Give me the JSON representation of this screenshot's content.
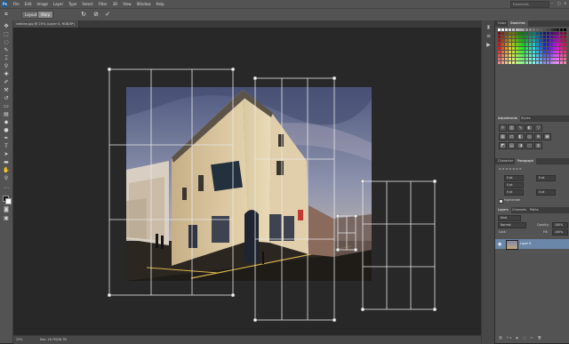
{
  "menubar": {
    "logo": "Ps",
    "items": [
      "File",
      "Edit",
      "Image",
      "Layer",
      "Type",
      "Select",
      "Filter",
      "3D",
      "View",
      "Window",
      "Help"
    ],
    "workspace": "Essentials",
    "winctl": [
      "–",
      "□",
      "✕"
    ]
  },
  "options": {
    "btn1": "Layout",
    "btn2": "Warp",
    "icons": [
      "rotate-icon",
      "cancel-icon",
      "commit-icon"
    ]
  },
  "document": {
    "tab": "rathlee.jpg @ 25% (Layer 0, RGB/8*) ✕",
    "zoom": "25%",
    "doc_size": "Doc: 16.7M/26.7M"
  },
  "panels": {
    "color_tabs": [
      "Color",
      "Swatches"
    ],
    "adjust_tabs": [
      "Adjustments",
      "Styles"
    ],
    "char_tabs": [
      "Character",
      "Paragraph"
    ],
    "para_fields": [
      "0 pt",
      "0 pt",
      "0 pt",
      "0 pt",
      "0 pt"
    ],
    "hyphenate": "Hyphenate",
    "layers_tabs": [
      "Layers",
      "Channels",
      "Paths"
    ],
    "layers_kind": "Kind",
    "blend_mode": "Normal",
    "opacity_label": "Opacity:",
    "opacity": "100%",
    "lock_label": "Lock:",
    "fill_label": "Fill:",
    "fill": "100%",
    "layer_name": "Layer 0"
  },
  "colors": {
    "accent": "#1f5a8c",
    "selected_layer": "#6a86a8",
    "ui_dark": "#282828",
    "panel": "#535353"
  }
}
